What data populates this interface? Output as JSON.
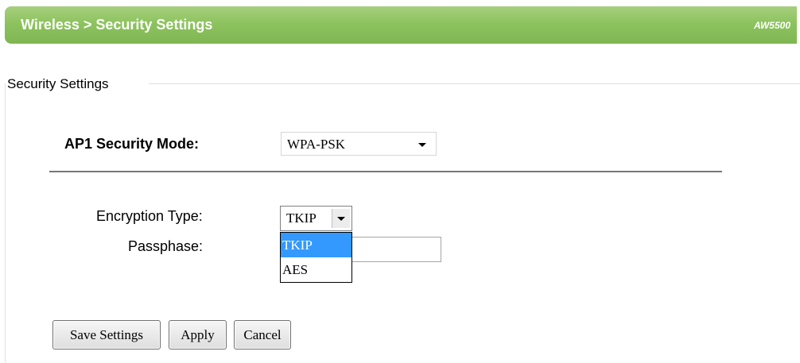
{
  "header": {
    "title": "Wireless > Security Settings",
    "model": "AW5500"
  },
  "section": {
    "legend": "Security Settings"
  },
  "security_mode": {
    "label": "AP1 Security Mode:",
    "selected": "WPA-PSK"
  },
  "encryption": {
    "label": "Encryption Type:",
    "selected": "TKIP",
    "options": [
      "TKIP",
      "AES"
    ],
    "highlighted_index": 0
  },
  "passphrase": {
    "label": "Passphase:",
    "value": ""
  },
  "buttons": {
    "save": "Save Settings",
    "apply": "Apply",
    "cancel": "Cancel"
  },
  "colors": {
    "header_green": "#8dc35f",
    "option_highlight": "#3399ff"
  }
}
